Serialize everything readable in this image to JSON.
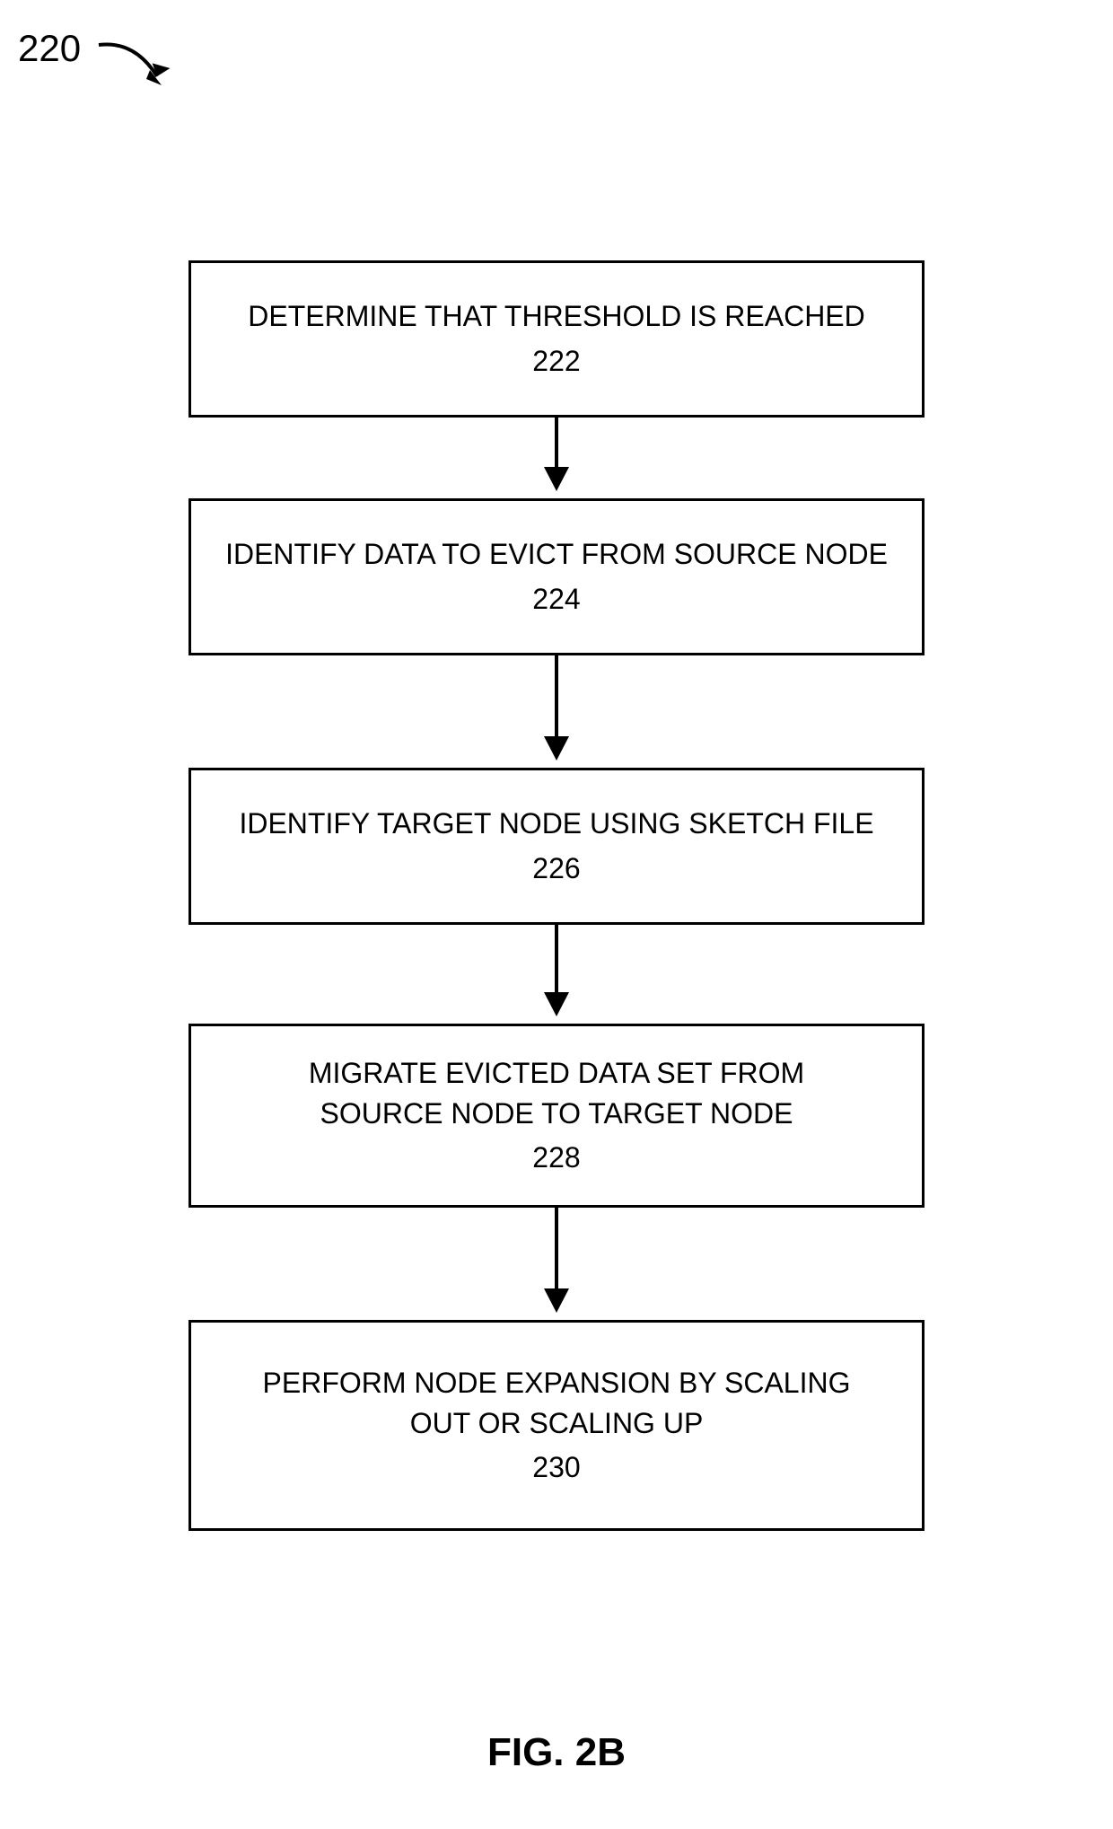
{
  "reference": {
    "number": "220"
  },
  "flowchart": {
    "boxes": [
      {
        "text": "DETERMINE THAT THRESHOLD IS REACHED",
        "number": "222"
      },
      {
        "text": "IDENTIFY DATA TO EVICT FROM SOURCE NODE",
        "number": "224"
      },
      {
        "text": "IDENTIFY TARGET NODE USING SKETCH FILE",
        "number": "226"
      },
      {
        "text": "MIGRATE EVICTED DATA SET FROM SOURCE NODE TO TARGET NODE",
        "number": "228"
      },
      {
        "text": "PERFORM NODE EXPANSION BY SCALING OUT OR SCALING UP",
        "number": "230"
      }
    ]
  },
  "figure": {
    "label": "FIG.  2B"
  }
}
